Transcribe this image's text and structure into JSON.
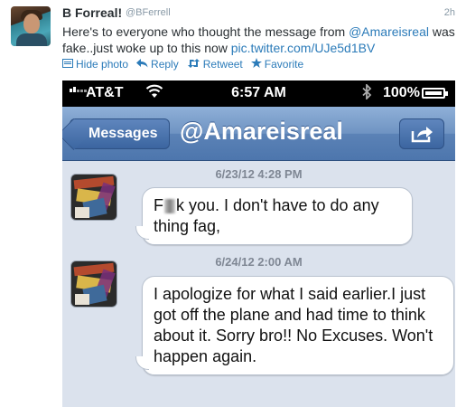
{
  "tweet": {
    "name": "B Forreal!",
    "handle": "@BFerrell",
    "time": "2h",
    "text_before": "Here's to everyone who thought the message from ",
    "mention": "@Amareisreal",
    "text_after": " was fake..just woke up to this now ",
    "link": "pic.twitter.com/UJe5d1BV",
    "actions": {
      "hide_photo": "Hide photo",
      "reply": "Reply",
      "retweet": "Retweet",
      "favorite": "Favorite"
    },
    "link_color": "#2b7bb9"
  },
  "phone": {
    "status": {
      "carrier": "AT&T",
      "time": "6:57 AM",
      "battery": "100%"
    },
    "nav": {
      "back_label": "Messages",
      "title": "@Amareisreal"
    },
    "messages": [
      {
        "timestamp": "6/23/12 4:28 PM",
        "text_a": "F",
        "text_b": "k you. I don't have to do any thing fag,"
      },
      {
        "timestamp": "6/24/12 2:00 AM",
        "text": "I apologize for what I said earlier.I just got off the plane and had time to think about it. Sorry bro!! No Excuses. Won't happen again."
      }
    ]
  }
}
